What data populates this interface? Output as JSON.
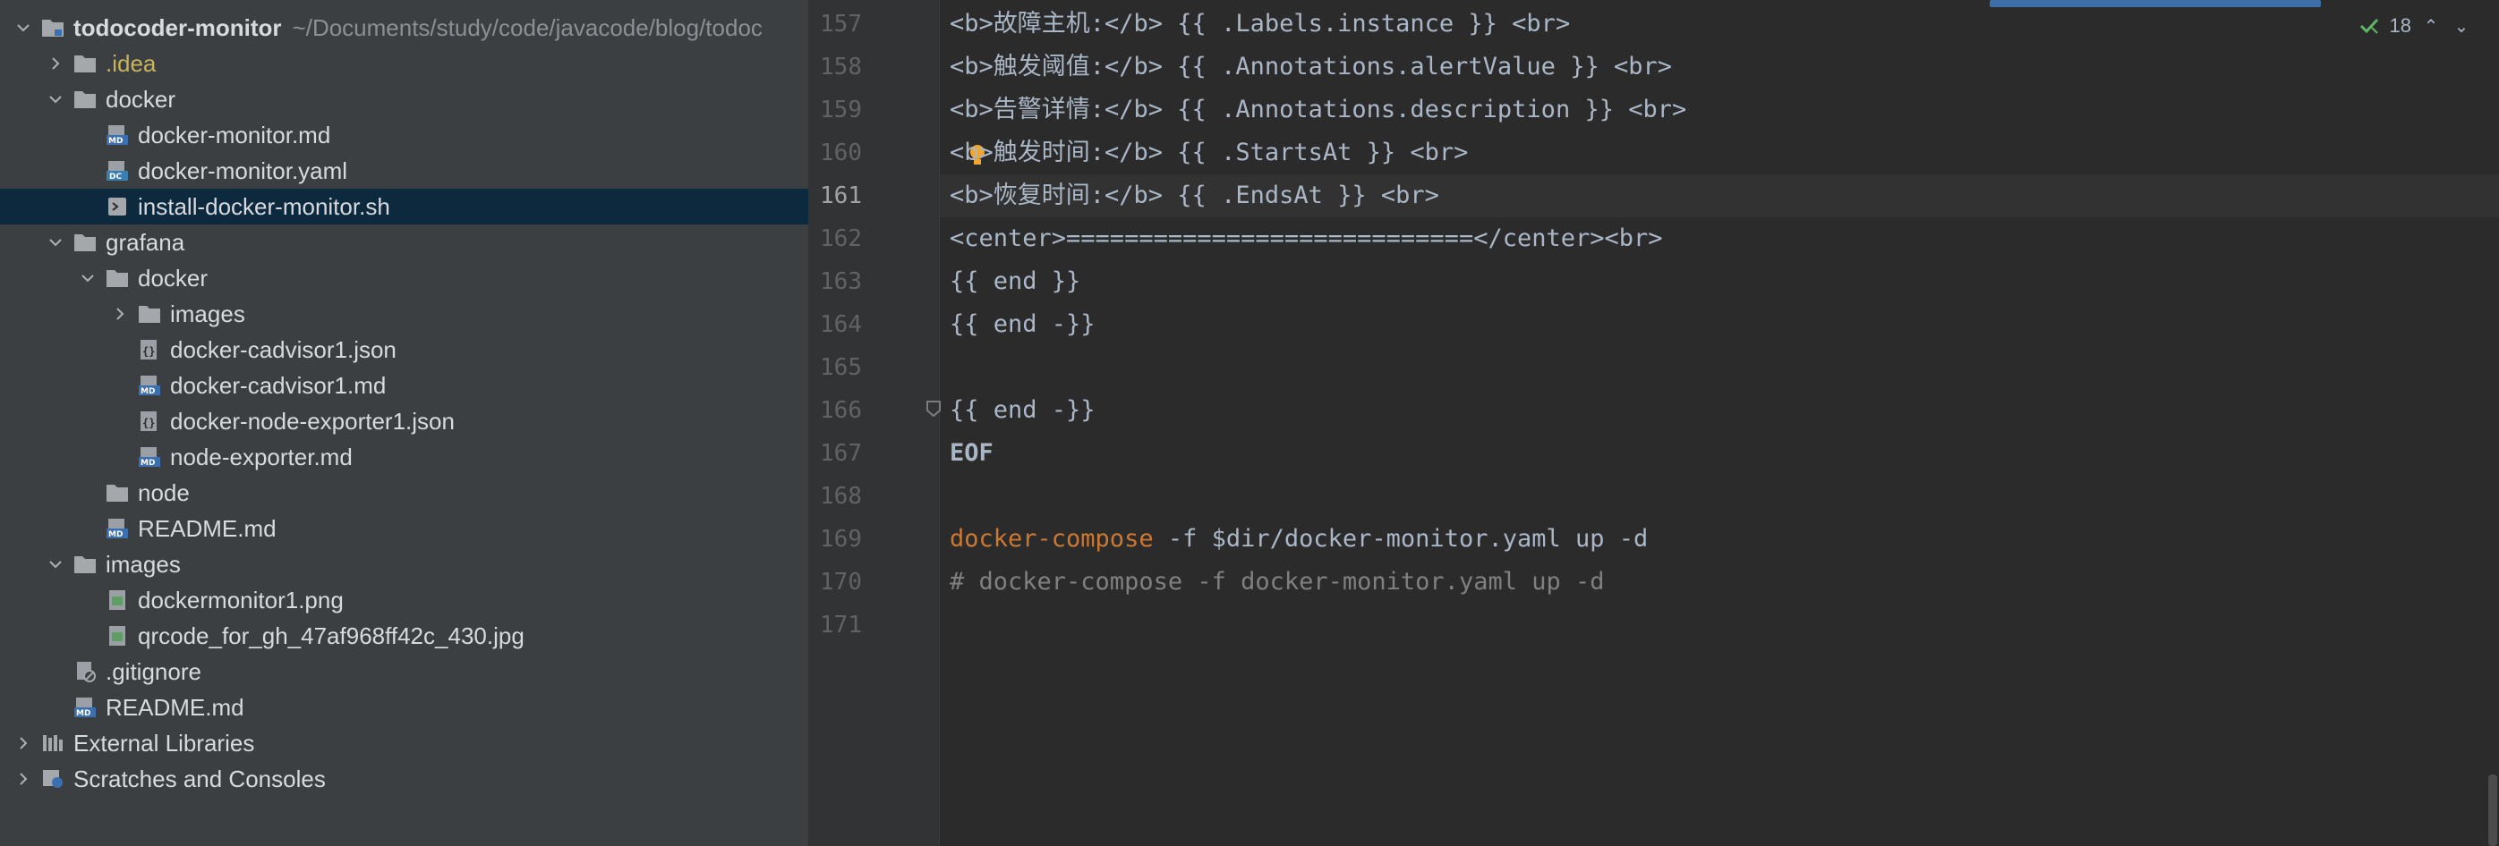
{
  "project_tree": {
    "root": {
      "name": "todocoder-monitor",
      "path": "~/Documents/study/code/javacode/blog/todoc"
    },
    "items": [
      {
        "label": ".idea"
      },
      {
        "label": "docker"
      },
      {
        "label": "docker-monitor.md"
      },
      {
        "label": "docker-monitor.yaml"
      },
      {
        "label": "install-docker-monitor.sh"
      },
      {
        "label": "grafana"
      },
      {
        "label": "docker"
      },
      {
        "label": "images"
      },
      {
        "label": "docker-cadvisor1.json"
      },
      {
        "label": "docker-cadvisor1.md"
      },
      {
        "label": "docker-node-exporter1.json"
      },
      {
        "label": "node-exporter.md"
      },
      {
        "label": "node"
      },
      {
        "label": "README.md"
      },
      {
        "label": "images"
      },
      {
        "label": "dockermonitor1.png"
      },
      {
        "label": "qrcode_for_gh_47af968ff42c_430.jpg"
      },
      {
        "label": ".gitignore"
      },
      {
        "label": "README.md"
      },
      {
        "label": "External Libraries"
      },
      {
        "label": "Scratches and Consoles"
      }
    ]
  },
  "editor": {
    "inspection": {
      "count": "18"
    },
    "lines": [
      {
        "num": "157",
        "text": "<b>故障主机:</b> {{ .Labels.instance }} <br>"
      },
      {
        "num": "158",
        "text": "<b>触发阈值:</b> {{ .Annotations.alertValue }} <br>"
      },
      {
        "num": "159",
        "text": "<b>告警详情:</b> {{ .Annotations.description }} <br>"
      },
      {
        "num": "160",
        "text": "<b>触发时间:</b> {{ .StartsAt }} <br>"
      },
      {
        "num": "161",
        "text": "<b>恢复时间:</b> {{ .EndsAt }} <br>"
      },
      {
        "num": "162",
        "text": "<center>============================</center><br>"
      },
      {
        "num": "163",
        "text": "{{ end }}"
      },
      {
        "num": "164",
        "text": "{{ end -}}"
      },
      {
        "num": "165",
        "text": ""
      },
      {
        "num": "166",
        "text": "{{ end -}}"
      },
      {
        "num": "167",
        "text": "EOF"
      },
      {
        "num": "168",
        "text": ""
      },
      {
        "num": "169",
        "kw": "docker-compose",
        "text": " -f $dir/docker-monitor.yaml up -d"
      },
      {
        "num": "170",
        "text": "# docker-compose -f docker-monitor.yaml up -d"
      },
      {
        "num": "171",
        "text": ""
      }
    ]
  },
  "colors": {
    "tree_bg": "#3c3f41",
    "editor_bg": "#2b2b2b",
    "selection": "#0d293e",
    "keyword": "#cc7832",
    "comment": "#808080"
  }
}
